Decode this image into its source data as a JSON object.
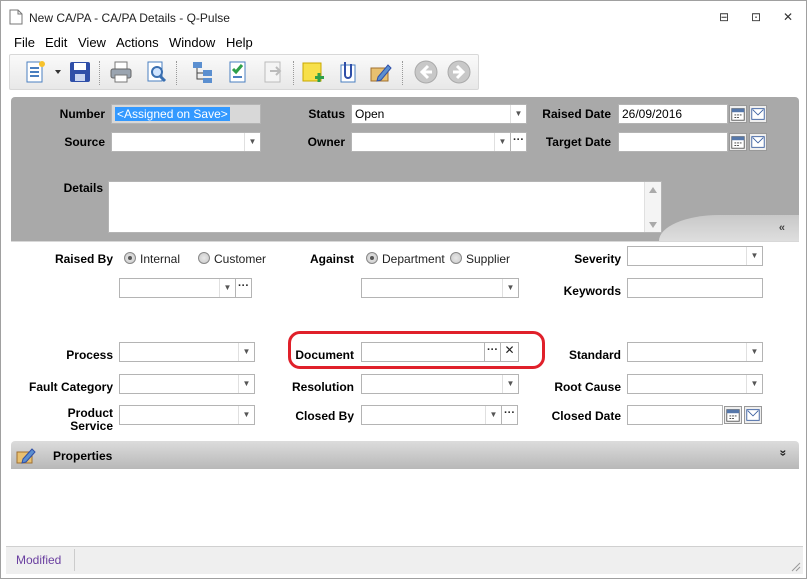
{
  "window": {
    "title": "New CA/PA - CA/PA Details - Q-Pulse",
    "minimize": "⊟",
    "restore": "⊡",
    "close": "✕"
  },
  "menu": [
    "File",
    "Edit",
    "View",
    "Actions",
    "Window",
    "Help"
  ],
  "header": {
    "number_label": "Number",
    "number_value": "<Assigned on Save>",
    "status_label": "Status",
    "status_value": "Open",
    "raised_date_label": "Raised Date",
    "raised_date_value": "26/09/2016",
    "source_label": "Source",
    "source_value": "",
    "owner_label": "Owner",
    "owner_value": "",
    "target_date_label": "Target Date",
    "target_date_value": "",
    "details_label": "Details",
    "details_value": "",
    "collapse_glyph": "«"
  },
  "body": {
    "raised_by_label": "Raised By",
    "raised_by_options": [
      "Internal",
      "Customer"
    ],
    "raised_by_selected": "Internal",
    "against_label": "Against",
    "against_options": [
      "Department",
      "Supplier"
    ],
    "against_selected": "Department",
    "severity_label": "Severity",
    "keywords_label": "Keywords",
    "process_label": "Process",
    "document_label": "Document",
    "standard_label": "Standard",
    "fault_category_label": "Fault Category",
    "resolution_label": "Resolution",
    "root_cause_label": "Root Cause",
    "product_service_label_1": "Product",
    "product_service_label_2": "Service",
    "closed_by_label": "Closed By",
    "closed_date_label": "Closed Date",
    "ellipsis": "···",
    "clear": "✕"
  },
  "properties": {
    "label": "Properties",
    "expand_glyph": "»"
  },
  "status": {
    "text": "Modified"
  },
  "colors": {
    "highlight": "#e0202a",
    "header_bg": "#a9a9a9",
    "selection": "#3399ff",
    "status_text": "#6a3fa0"
  }
}
